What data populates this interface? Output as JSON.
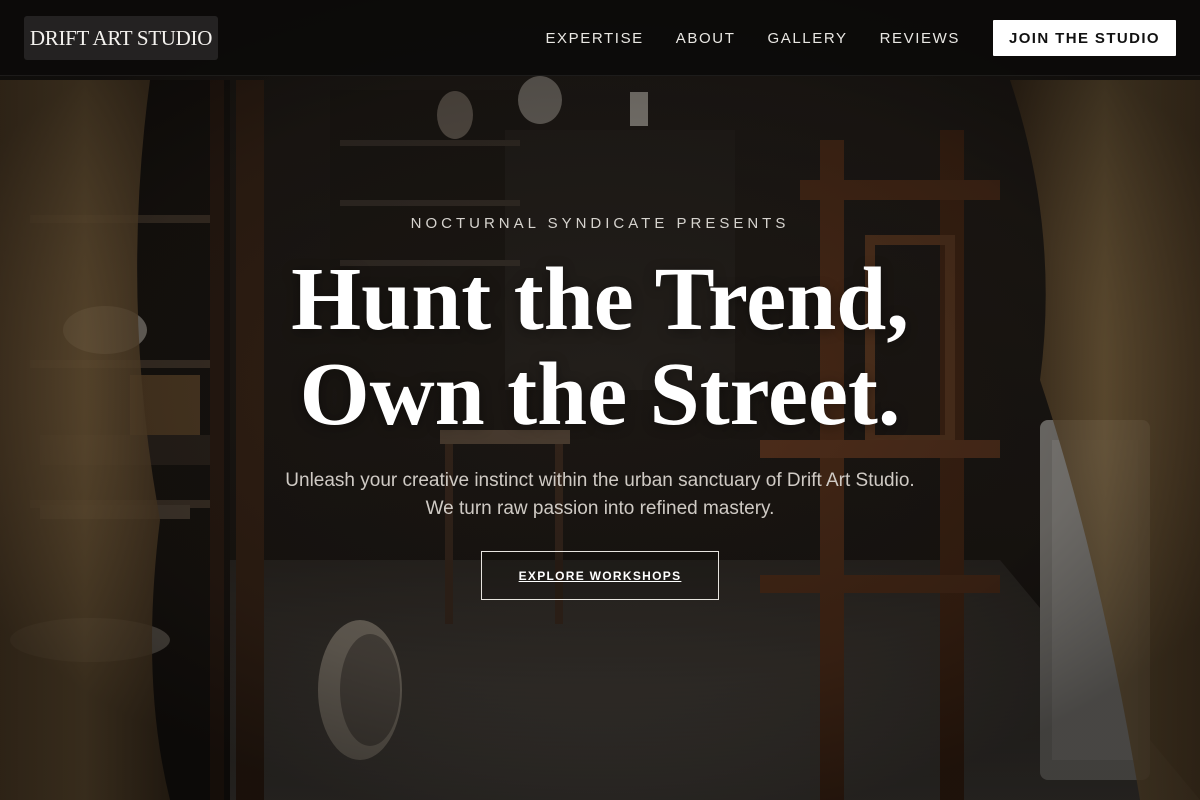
{
  "brand": {
    "logo_text": "DRIFT ART STUDIO"
  },
  "nav": {
    "items": [
      {
        "label": "EXPERTISE"
      },
      {
        "label": "ABOUT"
      },
      {
        "label": "GALLERY"
      },
      {
        "label": "REVIEWS"
      }
    ],
    "cta_label": "JOIN THE STUDIO"
  },
  "hero": {
    "eyebrow": "NOCTURNAL SYNDICATE PRESENTS",
    "headline_line1": "Hunt the Trend,",
    "headline_line2": "Own the Street.",
    "subcopy": "Unleash your creative instinct within the urban sanctuary of Drift Art Studio. We turn raw passion into refined mastery.",
    "cta_label": "EXPLORE WORKSHOPS"
  },
  "colors": {
    "header_bg": "#0c0b0a",
    "cta_bg": "#ffffff",
    "cta_text": "#111111",
    "headline": "#ffffff",
    "subcopy": "#cfcac4"
  }
}
